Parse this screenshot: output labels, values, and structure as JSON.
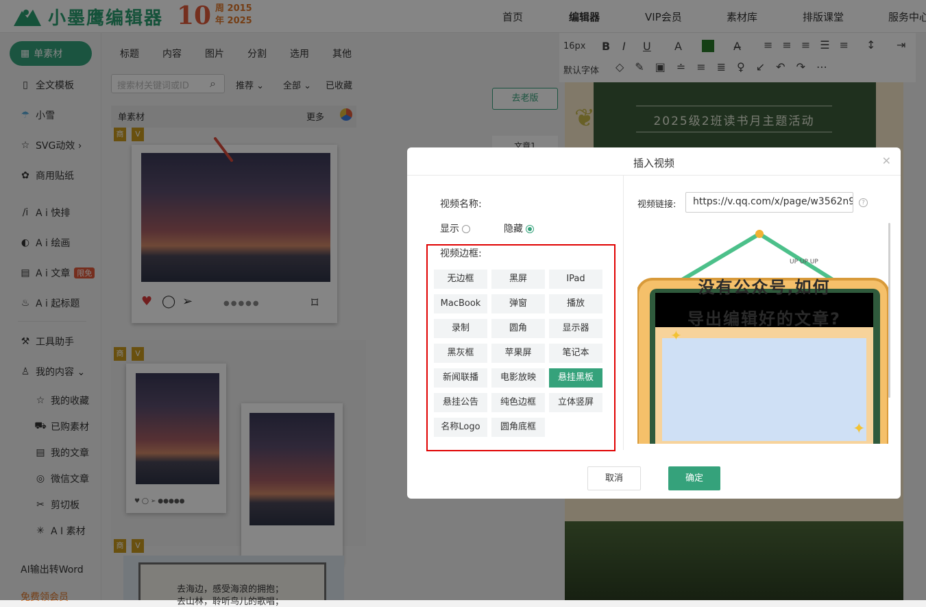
{
  "header": {
    "logo": "小墨鹰编辑器",
    "anniv_number": "10",
    "anniv_line1": "周 2015",
    "anniv_line2": "年 2025",
    "nav": [
      "首页",
      "编辑器",
      "VIP会员",
      "素材库",
      "排版课堂",
      "服务中心"
    ]
  },
  "sidebar": {
    "active": "单素材",
    "items": [
      "全文模板",
      "小雪",
      "SVG动效 ›",
      "商用贴纸",
      "A i 快排",
      "A i 绘画",
      "A i 文章",
      "A i 起标题",
      "工具助手",
      "我的内容 ⌄"
    ],
    "ai_article_tag": "限免",
    "sub_items": [
      "我的收藏",
      "已购素材",
      "我的文章",
      "微信文章",
      "剪切板",
      "A I 素材"
    ],
    "bottom": [
      "AI输出转Word",
      "免费领会员"
    ]
  },
  "panel": {
    "tabs": [
      "标题",
      "内容",
      "图片",
      "分割",
      "选用",
      "其他"
    ],
    "search_placeholder": "搜索材关键词或ID",
    "filters": [
      "推荐 ⌄",
      "全部 ⌄",
      "已收藏"
    ],
    "section_title": "单素材",
    "more": "更多",
    "badges": [
      "商",
      "V"
    ],
    "poem_line1": "去海边，感受海浪的拥抱；",
    "poem_line2": "去山林，聆听鸟儿的歌唱；"
  },
  "editor": {
    "font_size": "16px",
    "default_font": "默认字体",
    "old_version": "去老版",
    "doc_tab": "文章1",
    "canvas_title": "2025级2班读书月主题活动"
  },
  "dialog": {
    "title": "插入视频",
    "name_label": "视频名称:",
    "show_label": "显示",
    "hide_label": "隐藏",
    "name_display": "hide",
    "frame_label": "视频边框:",
    "frames": [
      "无边框",
      "黑屏",
      "IPad",
      "MacBook",
      "弹窗",
      "播放",
      "录制",
      "圆角",
      "显示器",
      "黑灰框",
      "苹果屏",
      "笔记本",
      "新闻联播",
      "电影放映",
      "悬挂黑板",
      "悬挂公告",
      "纯色边框",
      "立体竖屏",
      "名称Logo",
      "圆角底框"
    ],
    "selected_frame": "悬挂黑板",
    "url_label": "视频链接:",
    "url_value": "https://v.qq.com/x/page/w3562n9",
    "preview_line1": "没有公众号,如何",
    "preview_line2": "导出编辑好的文章?",
    "preview_topline": "UP UP UP",
    "cancel": "取消",
    "ok": "确定"
  },
  "colors": {
    "accent": "#35a27b",
    "highlight_box": "#e00000"
  }
}
